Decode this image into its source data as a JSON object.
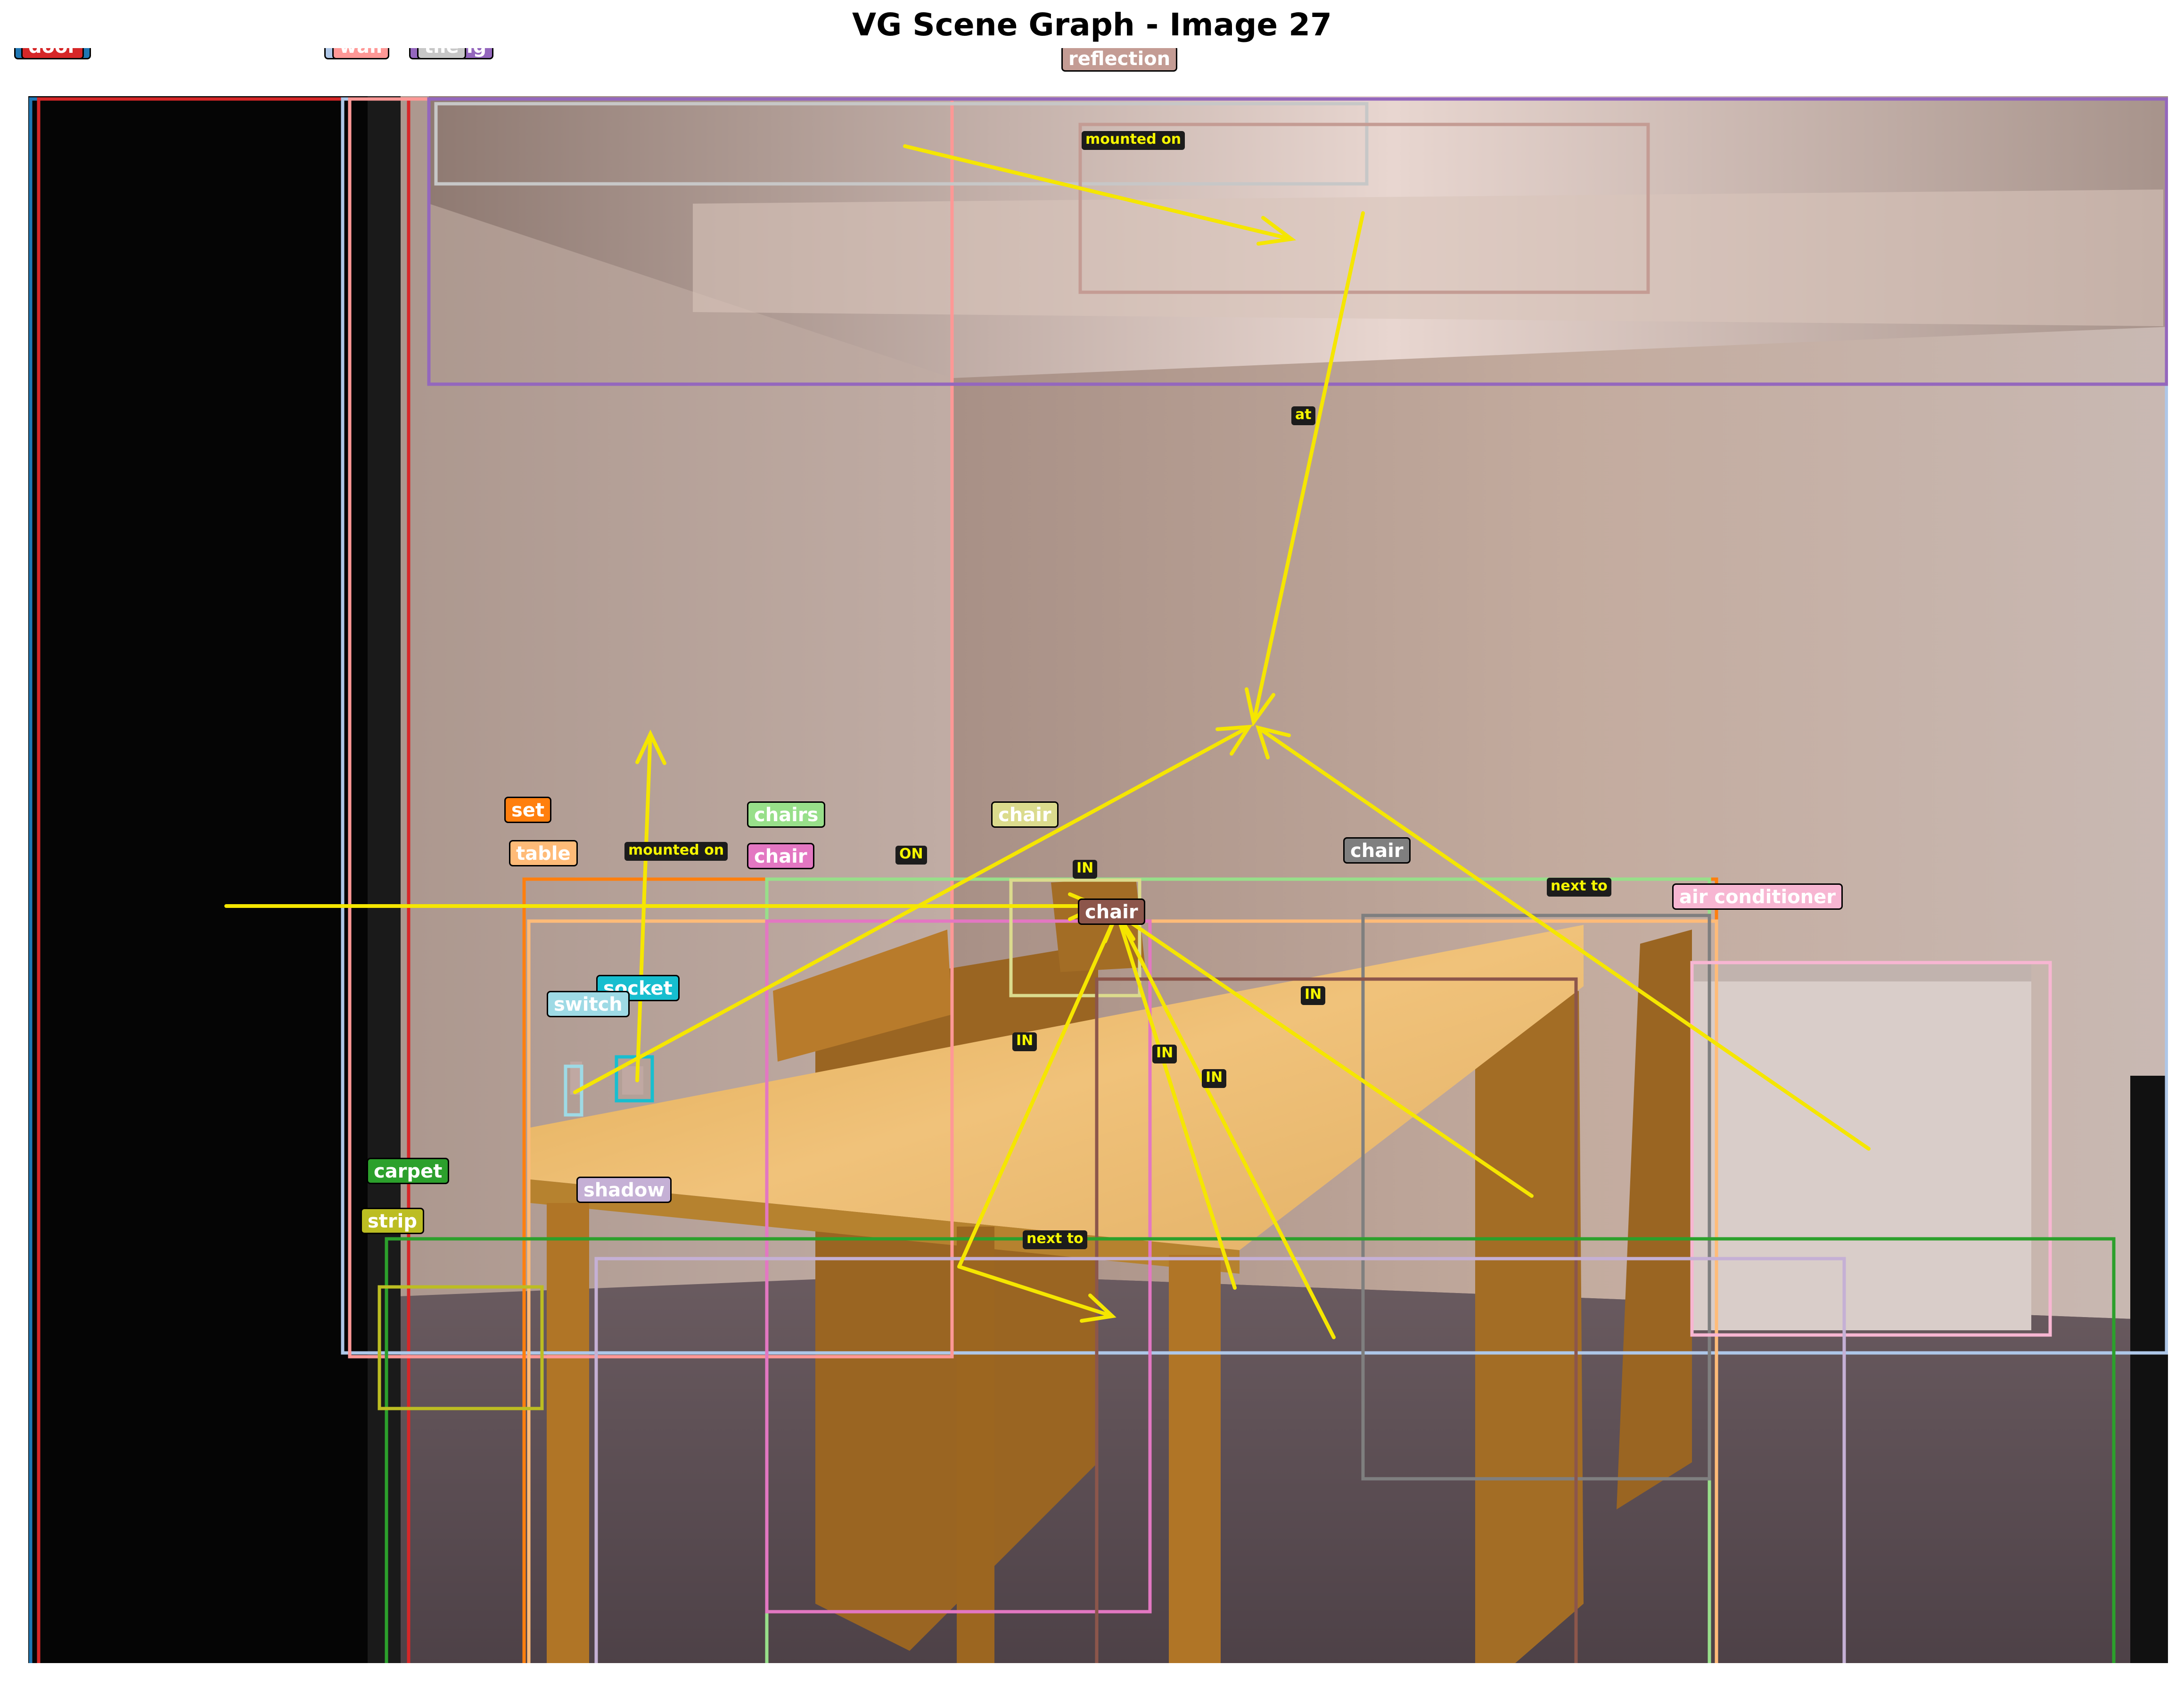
{
  "title": "VG Scene Graph - Image 27",
  "scene": {
    "colors": {
      "wall_back": "#c2a99b",
      "wall_left": "#b8a196",
      "ceiling": "#c6b4ab",
      "floor": "#5c4f55",
      "table": "#e8b461",
      "chair_wood": "#b4782a",
      "door": "#0a0a0a",
      "relation_arrow": "#ffff00",
      "relation_label_bg": "#1c1c1c"
    }
  },
  "objects": [
    {
      "label": "frame",
      "color": "#1f77b4"
    },
    {
      "label": "door",
      "color": "#d62728"
    },
    {
      "label": "wall",
      "color": "#aec7e8"
    },
    {
      "label": "wall",
      "color": "#ff9896"
    },
    {
      "label": "ceiling",
      "color": "#9467bd"
    },
    {
      "label": "tile",
      "color": "#c7c7c7"
    },
    {
      "label": "reflection",
      "color": "#c49c94"
    },
    {
      "label": "set",
      "color": "#ff7f0e"
    },
    {
      "label": "table",
      "color": "#ffbb78"
    },
    {
      "label": "chairs",
      "color": "#98df8a"
    },
    {
      "label": "chair",
      "color": "#e377c2"
    },
    {
      "label": "chair",
      "color": "#dbdb8d"
    },
    {
      "label": "chair",
      "color": "#7f7f7f"
    },
    {
      "label": "chair",
      "color": "#8c564b"
    },
    {
      "label": "air conditioner",
      "color": "#f7b6d2"
    },
    {
      "label": "socket",
      "color": "#17becf"
    },
    {
      "label": "switch",
      "color": "#9edae5"
    },
    {
      "label": "carpet",
      "color": "#2ca02c"
    },
    {
      "label": "strip",
      "color": "#bcbd22"
    },
    {
      "label": "shadow",
      "color": "#c5b0d5"
    }
  ],
  "relations": [
    {
      "label": "mounted on"
    },
    {
      "label": "at"
    },
    {
      "label": "mounted on"
    },
    {
      "label": "ON"
    },
    {
      "label": "IN"
    },
    {
      "label": "next to"
    },
    {
      "label": "IN"
    },
    {
      "label": "IN"
    },
    {
      "label": "IN"
    },
    {
      "label": "IN"
    },
    {
      "label": "next to"
    }
  ]
}
